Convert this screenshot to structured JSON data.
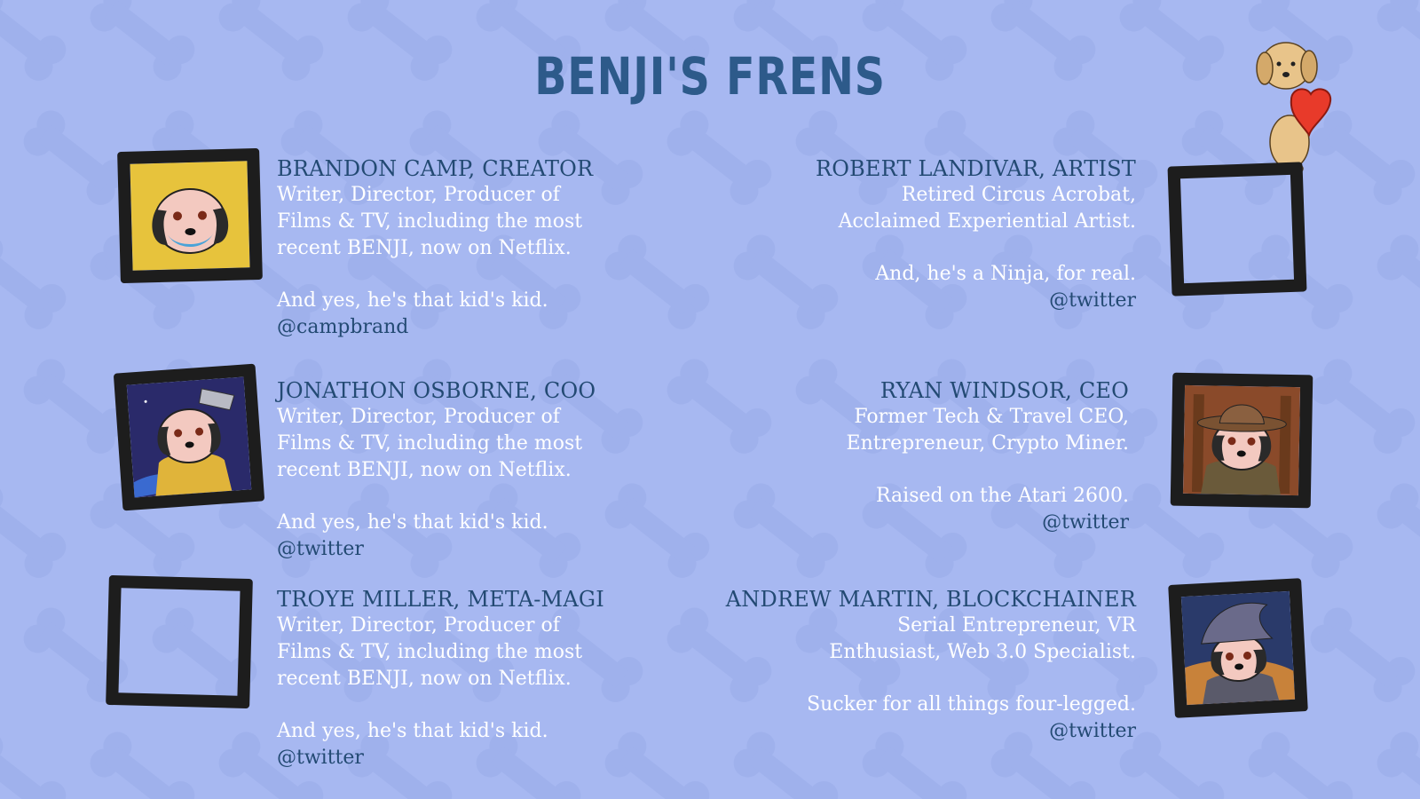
{
  "page": {
    "title": "BENJI'S FRENS",
    "colors": {
      "background": "#a7b8f1",
      "bone": "#9fb1ec",
      "title": "#2d5a8a",
      "name": "#234a73",
      "body": "#ffffff",
      "frame": "#1d1d1d"
    }
  },
  "team": [
    {
      "name": "BRANDON CAMP, CREATOR",
      "lines": [
        "Writer, Director, Producer of",
        "Films & TV, including the most",
        "recent BENJI, now on Netflix."
      ],
      "extra": "And yes, he's that kid's kid.",
      "handle": "@campbrand",
      "portrait": "dog-portrait-yellow"
    },
    {
      "name": "ROBERT LANDIVAR, ARTIST",
      "lines": [
        "Retired Circus Acrobat,",
        "Acclaimed Experiential Artist."
      ],
      "extra": "And, he's a Ninja, for real.",
      "handle": "@twitter",
      "portrait": "empty-frame"
    },
    {
      "name": "JONATHON OSBORNE, COO",
      "lines": [
        "Writer, Director, Producer of",
        "Films & TV, including the most",
        "recent BENJI, now on Netflix."
      ],
      "extra": "And yes, he's that kid's kid.",
      "handle": "@twitter",
      "portrait": "dog-portrait-space"
    },
    {
      "name": "RYAN WINDSOR, CEO",
      "lines": [
        "Former Tech & Travel CEO,",
        "Entrepreneur, Crypto Miner."
      ],
      "extra": "Raised on the Atari 2600.",
      "handle": "@twitter",
      "portrait": "dog-portrait-explorer"
    },
    {
      "name": "TROYE MILLER, META-MAGI",
      "lines": [
        "Writer, Director, Producer of",
        "Films & TV, including the most",
        "recent BENJI, now on Netflix."
      ],
      "extra": "And yes, he's that kid's kid.",
      "handle": "@twitter",
      "portrait": "empty-frame"
    },
    {
      "name": "ANDREW MARTIN, BLOCKCHAINER",
      "lines": [
        "Serial Entrepreneur, VR",
        "Enthusiast, Web 3.0 Specialist."
      ],
      "extra": "Sucker for all things four-legged.",
      "handle": "@twitter",
      "portrait": "dog-portrait-wizard"
    }
  ],
  "decor": {
    "mascot": "puppy-with-heart-icon"
  }
}
